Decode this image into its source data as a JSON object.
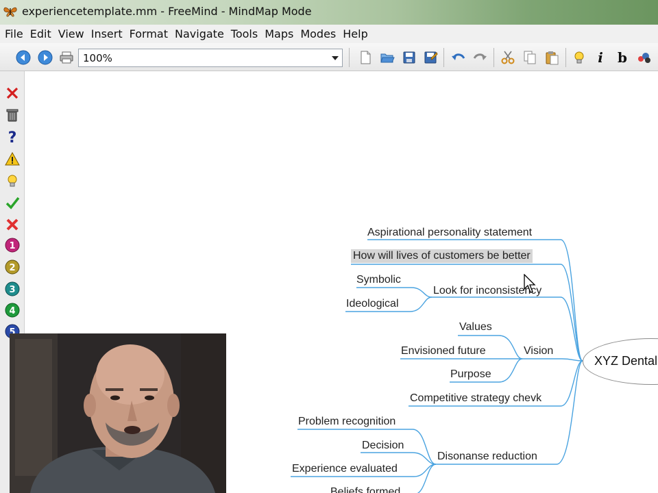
{
  "window": {
    "title": "experiencetemplate.mm - FreeMind - MindMap Mode"
  },
  "menu": [
    "File",
    "Edit",
    "View",
    "Insert",
    "Format",
    "Navigate",
    "Tools",
    "Maps",
    "Modes",
    "Help"
  ],
  "toolbar": {
    "zoom": "100%",
    "buttons": [
      "back-icon",
      "forward-icon",
      "print-icon",
      "new-document-icon",
      "open-folder-icon",
      "save-icon",
      "save-as-icon",
      "undo-icon",
      "redo-icon",
      "cut-icon",
      "copy-icon",
      "paste-icon",
      "bulb-icon",
      "italic-icon",
      "bold-icon",
      "cloud-icon"
    ],
    "italic_label": "i",
    "bold_label": "b"
  },
  "left_toolbar": {
    "icons": [
      "remove-icon",
      "trash-icon",
      "question-icon",
      "warning-icon",
      "idea-icon",
      "checkmark-icon",
      "cross-icon",
      "priority-1-icon",
      "priority-2-icon",
      "priority-3-icon",
      "priority-4-icon",
      "priority-5-icon"
    ],
    "priority_labels": [
      "1",
      "2",
      "3",
      "4",
      "5"
    ]
  },
  "mindmap": {
    "root": "XYZ Dental",
    "nodes": {
      "aspirational": "Aspirational personality statement",
      "how_will_lives": "How will lives of customers be better",
      "look_for": "Look for inconsistency",
      "symbolic": "Symbolic",
      "ideological": "Ideological",
      "vision": "Vision",
      "values": "Values",
      "envisioned": "Envisioned future",
      "purpose": "Purpose",
      "competitive": "Competitive strategy chevk",
      "disonanse": "Disonanse reduction",
      "problem": "Problem recognition",
      "decision": "Decision",
      "experience": "Experience evaluated",
      "beliefs": "Beliefs formed"
    },
    "selected_node": "how_will_lives",
    "edge_color": "#4aa3e0"
  },
  "colors": {
    "accent": "#4aa3e0",
    "selected_bg": "#d6d6d6"
  }
}
